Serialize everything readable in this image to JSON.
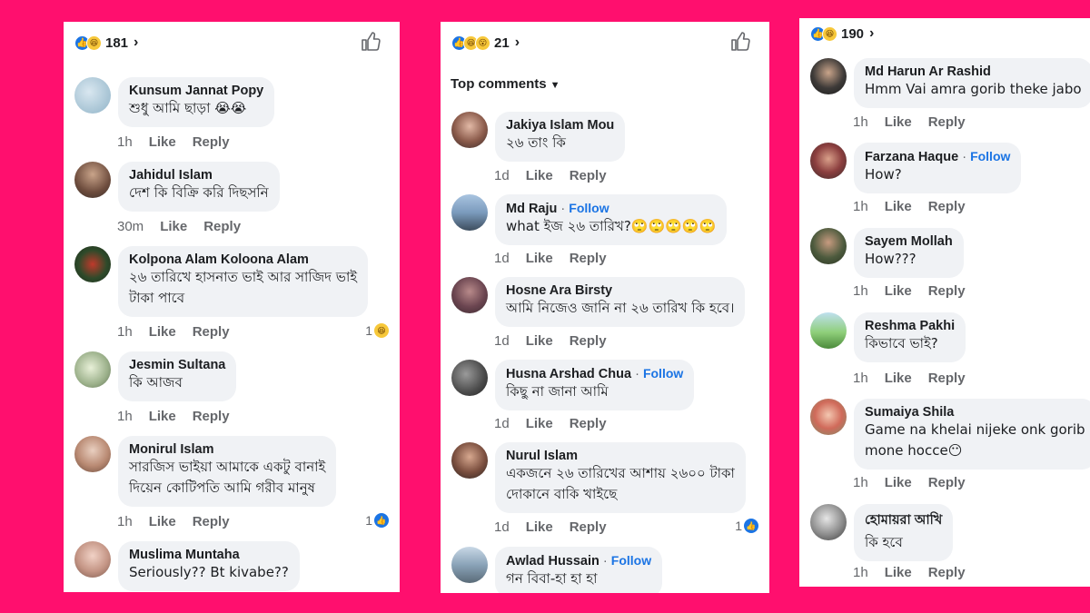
{
  "colors": {
    "background": "#ff0f6e",
    "link": "#1b74e4",
    "bubble": "#f0f2f5",
    "meta": "#65676b"
  },
  "actions": {
    "like": "Like",
    "reply": "Reply",
    "follow": "Follow"
  },
  "panel1": {
    "reaction_count": "181",
    "reactions": [
      "like-icon",
      "haha-icon"
    ],
    "comments": [
      {
        "name": "Kunsum Jannat Popy",
        "lines": [
          "শুধু আমি ছাড়া 😭😭"
        ],
        "time": "1h"
      },
      {
        "name": "Jahidul Islam",
        "lines": [
          "দেশ কি বিক্রি করি দিছসনি"
        ],
        "time": "30m"
      },
      {
        "name": "Kolpona Alam Koloona Alam",
        "lines": [
          "২৬ তারিখে হাসনাত ভাই আর সাজিদ ভাই",
          "টাকা পাবে"
        ],
        "time": "1h",
        "react_count": "1",
        "react_icon": "haha-icon"
      },
      {
        "name": "Jesmin Sultana",
        "lines": [
          "কি আজব"
        ],
        "time": "1h"
      },
      {
        "name": "Monirul Islam",
        "lines": [
          "সারজিস ভাইয়া আমাকে একটু বানাই",
          "দিয়েন কোটিপতি আমি গরীব মানুষ"
        ],
        "time": "1h",
        "react_count": "1",
        "react_icon": "like-icon"
      },
      {
        "name": "Muslima Muntaha",
        "lines": [
          "Seriously?? Bt kivabe??"
        ],
        "time": ""
      }
    ]
  },
  "panel2": {
    "reaction_count": "21",
    "reactions": [
      "like-icon",
      "haha-icon",
      "wow-icon"
    ],
    "top_comments_label": "Top comments",
    "comments": [
      {
        "name": "Jakiya Islam Mou",
        "lines": [
          "২৬ তাং কি"
        ],
        "time": "1d"
      },
      {
        "name": "Md Raju",
        "follow": true,
        "lines": [
          "what ইজ ২৬ তারিখ?🙄🙄🙄🙄🙄"
        ],
        "time": "1d"
      },
      {
        "name": "Hosne Ara Birsty",
        "lines": [
          "আমি নিজেও জানি না ২৬ তারিখ কি হবে।"
        ],
        "time": "1d"
      },
      {
        "name": "Husna Arshad Chua",
        "follow": true,
        "lines": [
          "কিছু না জানা আমি"
        ],
        "time": "1d"
      },
      {
        "name": "Nurul Islam",
        "lines": [
          "একজনে ২৬ তারিখের আশায় ২৬০০ টাকা",
          "দোকানে বাকি খাইছে"
        ],
        "time": "1d",
        "react_count": "1",
        "react_icon": "like-icon"
      },
      {
        "name": "Awlad Hussain",
        "follow": true,
        "lines": [
          "গন বিবা-হা হা হা"
        ],
        "time": ""
      }
    ]
  },
  "panel3": {
    "reaction_count": "190",
    "reactions": [
      "like-icon",
      "haha-icon"
    ],
    "comments": [
      {
        "name": "Md Harun Ar Rashid",
        "lines": [
          "Hmm Vai amra gorib theke jabo"
        ],
        "time": "1h"
      },
      {
        "name": "Farzana Haque",
        "follow": true,
        "lines": [
          "How?"
        ],
        "time": "1h"
      },
      {
        "name": "Sayem Mollah",
        "lines": [
          "How???"
        ],
        "time": "1h"
      },
      {
        "name": "Reshma Pakhi",
        "lines": [
          "কিভাবে ভাই?"
        ],
        "time": "1h"
      },
      {
        "name": "Sumaiya Shila",
        "lines": [
          "Game na khelai nijeke onk gorib",
          "mone hocce😶"
        ],
        "time": "1h"
      },
      {
        "name": "হোমায়রা আখি",
        "lines": [
          "কি হবে"
        ],
        "time": "1h"
      }
    ]
  }
}
